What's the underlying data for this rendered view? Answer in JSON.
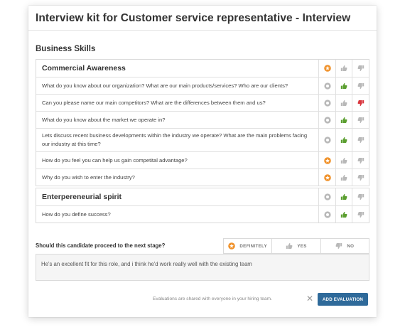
{
  "kit_title": "Interview kit for Customer service representative - Interview",
  "section_title": "Business Skills",
  "colors": {
    "star": "#f0922b",
    "thumb_up": "#5a9e2f",
    "thumb_down": "#d9363e",
    "neutral": "#b8b8b8",
    "button": "#2f6a9a"
  },
  "groups": [
    {
      "heading": "Commercial Awareness",
      "rating": "star",
      "questions": [
        {
          "text": "What do you know about our organization? What are our main products/services? Who are our clients?",
          "rating": "up"
        },
        {
          "text": "Can you please name our main competitors? What are the differences between them and us?",
          "rating": "down"
        },
        {
          "text": "What do you know about the market we operate in?",
          "rating": "up"
        },
        {
          "text": "Lets discuss recent business developments within the industry we operate? What are the main problems facing our industry at this time?",
          "rating": "up"
        },
        {
          "text": "How do you feel you can help us gain competital advantage?",
          "rating": "star"
        },
        {
          "text": "Why do you wish to enter the industry?",
          "rating": "star"
        }
      ]
    },
    {
      "heading": "Enterpereneurial spirit",
      "rating": "up",
      "questions": [
        {
          "text": "How do you define success?",
          "rating": "up"
        }
      ]
    }
  ],
  "proceed": {
    "question": "Should this candidate proceed to the next stage?",
    "options": [
      "DEFINITELY",
      "YES",
      "NO"
    ],
    "selected": "DEFINITELY"
  },
  "comment": "He's an excellent fit for this role, and i think he'd work really well with the existing team",
  "footer_note": "Evaluations are shared with everyone in your hiring team.",
  "close_symbol": "✕",
  "add_button_label": "ADD EVALUATION"
}
